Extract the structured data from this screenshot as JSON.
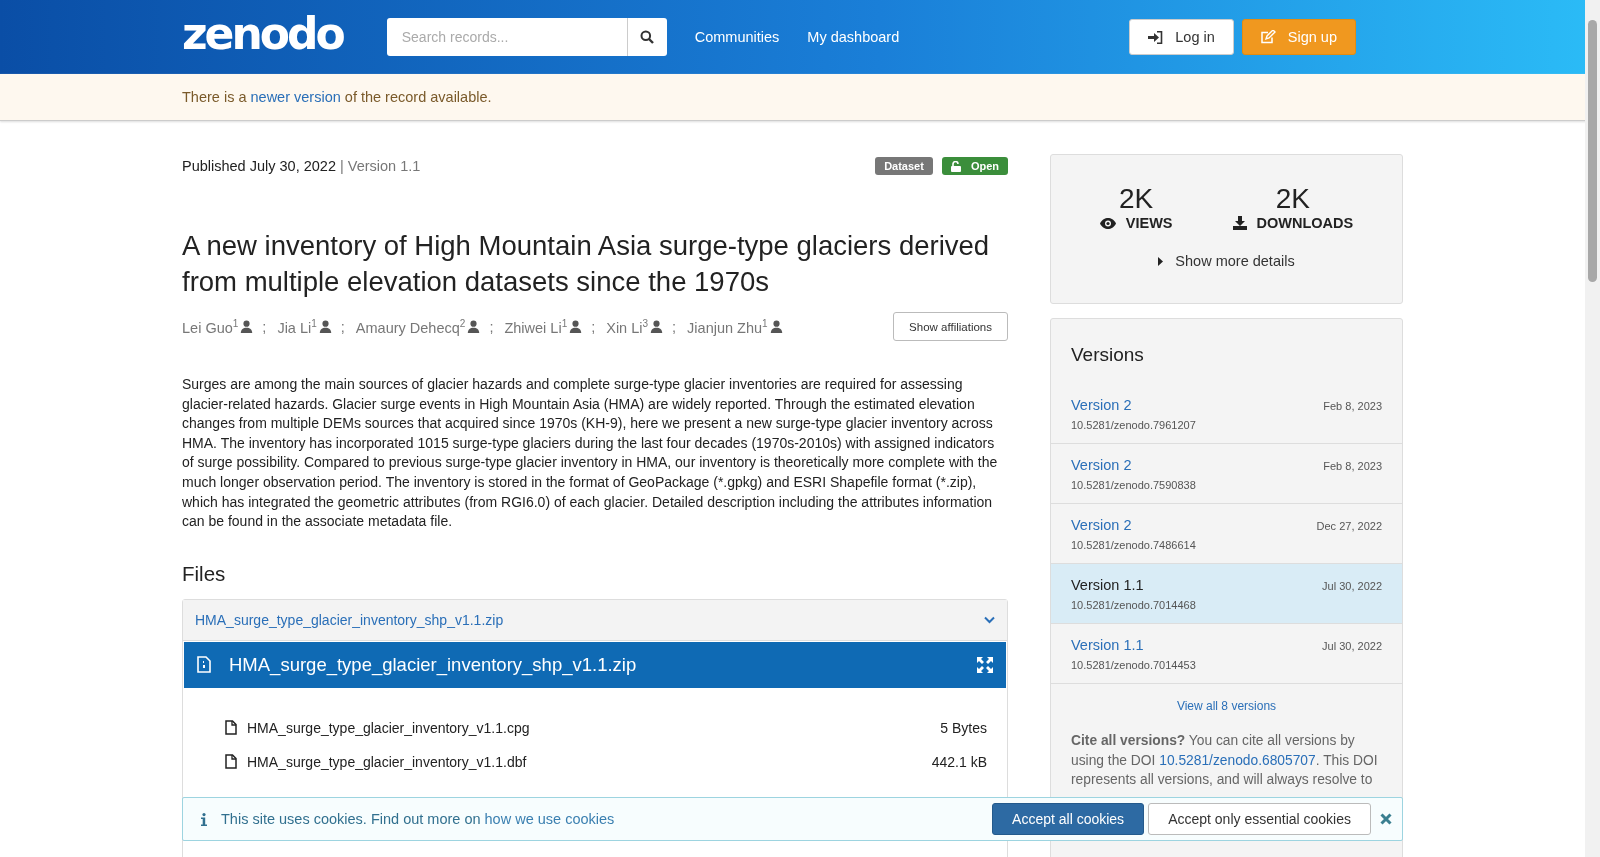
{
  "header": {
    "logo": "zenodo",
    "search": {
      "placeholder": "Search records..."
    },
    "nav": [
      "Communities",
      "My dashboard"
    ],
    "login": "Log in",
    "signup": "Sign up"
  },
  "notice": {
    "before": "There is a",
    "link": "newer version",
    "after": "of the record available."
  },
  "record": {
    "published": "Published July 30, 2022",
    "version": "| Version 1.1",
    "badges": [
      {
        "label": "Dataset",
        "kind": "type"
      },
      {
        "label": "Open",
        "kind": "access"
      }
    ],
    "title": "A new inventory of High Mountain Asia surge-type glaciers derived from multiple elevation datasets since the 1970s",
    "authors": [
      {
        "name": "Lei Guo",
        "aff": "1",
        "sep": ";"
      },
      {
        "name": "Jia Li",
        "aff": "1",
        "sep": ";"
      },
      {
        "name": "Amaury Dehecq",
        "aff": "2",
        "sep": ";"
      },
      {
        "name": "Zhiwei Li",
        "aff": "1",
        "sep": ";"
      },
      {
        "name": "Xin Li",
        "aff": "3",
        "sep": ";"
      },
      {
        "name": "Jianjun Zhu",
        "aff": "1"
      }
    ],
    "show_affiliations": "Show affiliations",
    "description": "Surges are among the main sources of glacier hazards and complete surge-type glacier inventories are required for assessing glacier-related hazards. Glacier surge events in High Mountain Asia (HMA) are widely reported. Through the estimated elevation changes from multiple DEMs sources that acquired since 1970s (KH-9), here we present a new surge-type glacier inventory across HMA. The inventory has incorporated 1015 surge-type glaciers during the last four decades (1970s-2010s) with assigned indicators of surge possibility. Compared to previous surge-type glacier inventory in HMA, our inventory is theoretically more complete with the much longer observation period. The inventory is stored in the format of GeoPackage (*.gpkg) and ESRI Shapefile format (*.zip), which has integrated the geometric attributes (from RGI6.0) of each glacier. Detailed description including the attributes information can be found in the associate metadata file.",
    "files": {
      "heading": "Files",
      "archive": "HMA_surge_type_glacier_inventory_shp_v1.1.zip",
      "preview_title": "HMA_surge_type_glacier_inventory_shp_v1.1.zip",
      "entries": [
        {
          "name": "HMA_surge_type_glacier_inventory_v1.1.cpg",
          "size": "5 Bytes"
        },
        {
          "name": "HMA_surge_type_glacier_inventory_v1.1.dbf",
          "size": "442.1 kB"
        }
      ]
    }
  },
  "stats": [
    {
      "value": "2K",
      "label": "VIEWS",
      "kind": "views"
    },
    {
      "value": "2K",
      "label": "DOWNLOADS",
      "kind": "downloads"
    }
  ],
  "show_more": "Show more details",
  "versions": {
    "heading": "Versions",
    "items": [
      {
        "name": "Version 2",
        "date": "Feb 8, 2023",
        "doi": "10.5281/zenodo.7961207",
        "selected": false
      },
      {
        "name": "Version 2",
        "date": "Feb 8, 2023",
        "doi": "10.5281/zenodo.7590838",
        "selected": false
      },
      {
        "name": "Version 2",
        "date": "Dec 27, 2022",
        "doi": "10.5281/zenodo.7486614",
        "selected": false
      },
      {
        "name": "Version 1.1",
        "date": "Jul 30, 2022",
        "doi": "10.5281/zenodo.7014468",
        "selected": true
      },
      {
        "name": "Version 1.1",
        "date": "Jul 30, 2022",
        "doi": "10.5281/zenodo.7014453",
        "selected": false
      }
    ],
    "view_all": "View all 8 versions",
    "cite": {
      "lead": "Cite all versions?",
      "before": "You can cite all versions by using the DOI",
      "link": "10.5281/zenodo.6805707",
      "after": ". This DOI represents all versions, and will always resolve to"
    }
  },
  "cookies": {
    "text": "This site uses cookies. Find out more on",
    "link": "how we use cookies",
    "accept_all": "Accept all cookies",
    "accept_essential": "Accept only essential cookies"
  }
}
